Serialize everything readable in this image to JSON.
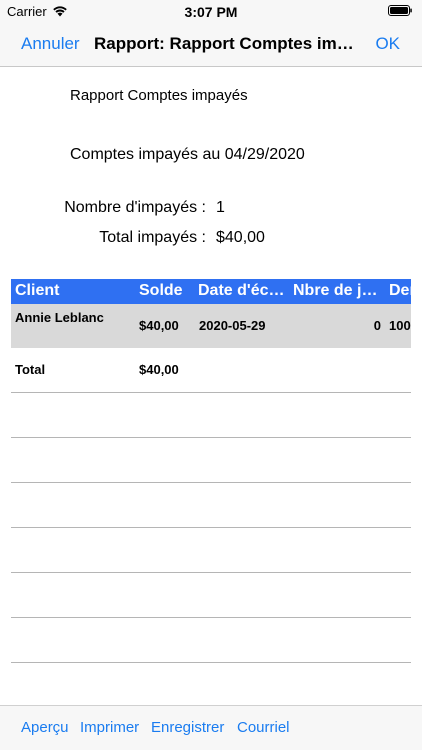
{
  "status_bar": {
    "carrier": "Carrier",
    "time": "3:07 PM"
  },
  "nav": {
    "cancel_label": "Annuler",
    "title": "Rapport: Rapport Comptes impayés",
    "ok_label": "OK"
  },
  "report": {
    "title": "Rapport Comptes impayés",
    "date_line": "Comptes impayés au 04/29/2020",
    "count_label": "Nombre d'impayés :",
    "count_value": "1",
    "total_label": "Total impayés :",
    "total_value": "$40,00"
  },
  "table": {
    "headers": [
      "Client",
      "Solde",
      "Date d'échéance",
      "Nbre de jours",
      "Dernier"
    ],
    "rows": [
      {
        "client": "Annie Leblanc",
        "solde": "$40,00",
        "date": "2020-05-29",
        "nbre": "0",
        "dernier": "100"
      }
    ],
    "total_row": {
      "label": "Total",
      "solde": "$40,00"
    }
  },
  "toolbar": {
    "apercu": "Aperçu",
    "imprimer": "Imprimer",
    "enregistrer": "Enregistrer",
    "courriel": "Courriel"
  },
  "colors": {
    "accent": "#1a7cf0",
    "table_header": "#2f70f2",
    "row_highlight": "#d9d9d9"
  }
}
